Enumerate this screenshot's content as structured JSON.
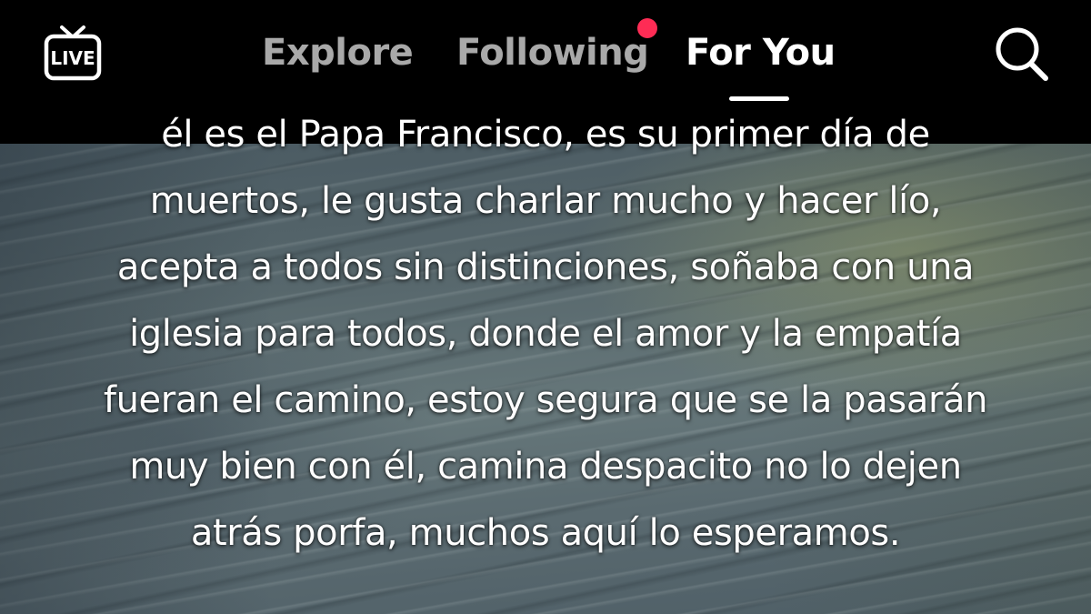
{
  "top_bar": {
    "live_label": "LIVE",
    "tabs": [
      {
        "label": "Explore",
        "active": false
      },
      {
        "label": "Following",
        "active": false,
        "has_notification": true
      },
      {
        "label": "For You",
        "active": true
      }
    ],
    "search_icon": "search-icon"
  },
  "colors": {
    "notification_dot": "#fe2c55",
    "active_tab": "#ffffff",
    "inactive_tab": "#a9a9a9"
  },
  "caption": {
    "lines": [
      "él es el Papa Francisco, es su primer día de",
      "muertos, le gusta charlar mucho y hacer lío,",
      "acepta a todos sin distinciones, soñaba con una",
      "iglesia para todos, donde el amor y la empatía",
      "fueran el camino, estoy segura que se la pasarán",
      "muy bien con él, camina despacito no lo dejen",
      "atrás porfa, muchos aquí lo esperamos."
    ]
  }
}
